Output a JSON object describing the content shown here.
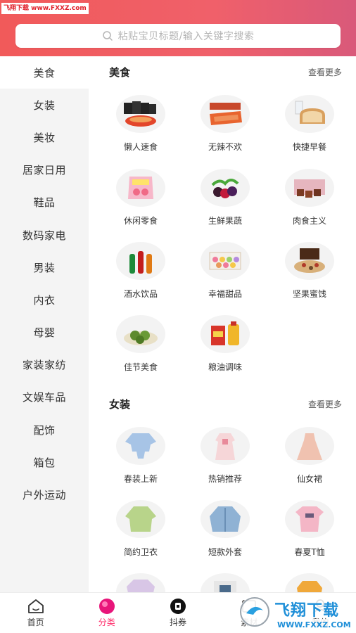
{
  "watermark_top": "飞翔下载 www.FXXZ.com",
  "search": {
    "placeholder": "粘贴宝贝标题/输入关键字搜索"
  },
  "sidebar": {
    "items": [
      {
        "label": "美食"
      },
      {
        "label": "女装"
      },
      {
        "label": "美妆"
      },
      {
        "label": "居家日用"
      },
      {
        "label": "鞋品"
      },
      {
        "label": "数码家电"
      },
      {
        "label": "男装"
      },
      {
        "label": "内衣"
      },
      {
        "label": "母婴"
      },
      {
        "label": "家装家纺"
      },
      {
        "label": "文娱车品"
      },
      {
        "label": "配饰"
      },
      {
        "label": "箱包"
      },
      {
        "label": "户外运动"
      }
    ],
    "active_index": 0
  },
  "sections": [
    {
      "title": "美食",
      "more": "查看更多",
      "items": [
        {
          "label": "懒人速食"
        },
        {
          "label": "无辣不欢"
        },
        {
          "label": "快捷早餐"
        },
        {
          "label": "休闲零食"
        },
        {
          "label": "生鲜果蔬"
        },
        {
          "label": "肉食主义"
        },
        {
          "label": "酒水饮品"
        },
        {
          "label": "幸福甜品"
        },
        {
          "label": "坚果蜜饯"
        },
        {
          "label": "佳节美食"
        },
        {
          "label": "粮油调味"
        }
      ]
    },
    {
      "title": "女装",
      "more": "查看更多",
      "items": [
        {
          "label": "春装上新"
        },
        {
          "label": "热销推荐"
        },
        {
          "label": "仙女裙"
        },
        {
          "label": "简约卫衣"
        },
        {
          "label": "短款外套"
        },
        {
          "label": "春夏T恤"
        }
      ]
    }
  ],
  "tabbar": {
    "items": [
      {
        "label": "首页",
        "icon": "home-icon"
      },
      {
        "label": "分类",
        "icon": "category-icon"
      },
      {
        "label": "抖券",
        "icon": "douyin-icon"
      },
      {
        "label": "素材",
        "icon": "material-icon"
      },
      {
        "label": "我的",
        "icon": "profile-icon"
      }
    ],
    "active_index": 1
  },
  "watermark_bottom": {
    "line1": "飞翔下载",
    "line2": "WWW.FXXZ.COM"
  },
  "colors": {
    "header_start": "#f15a5a",
    "header_end": "#d9597a",
    "accent": "#ff2c6a",
    "sidebar_bg": "#f4f4f4"
  }
}
